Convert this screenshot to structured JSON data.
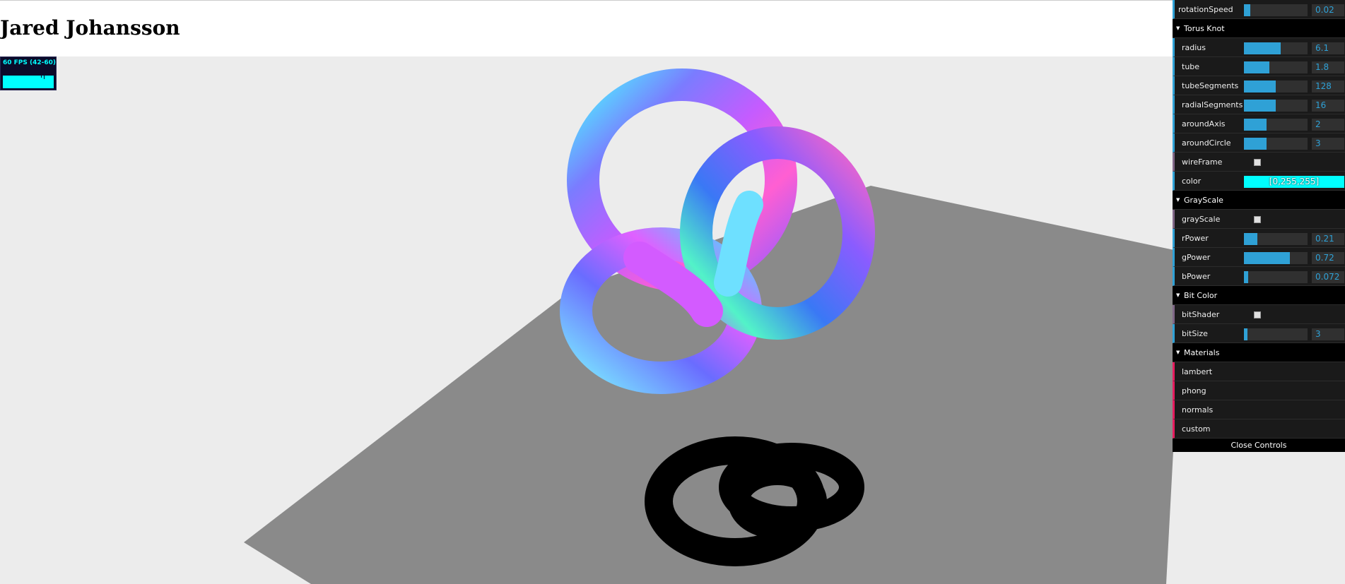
{
  "page": {
    "title": "Jared Johansson"
  },
  "stats": {
    "fps_text": "60 FPS (42-60)"
  },
  "gui": {
    "top": {
      "label": "rotationSpeed",
      "value": "0.02",
      "fill": 0.1
    },
    "folders": [
      {
        "name": "Torus Knot",
        "controls": [
          {
            "label": "radius",
            "type": "number",
            "value": "6.1",
            "fill": 0.58
          },
          {
            "label": "tube",
            "type": "number",
            "value": "1.8",
            "fill": 0.4
          },
          {
            "label": "tubeSegments",
            "type": "number",
            "value": "128",
            "fill": 0.5
          },
          {
            "label": "radialSegments",
            "type": "number",
            "value": "16",
            "fill": 0.5
          },
          {
            "label": "aroundAxis",
            "type": "number",
            "value": "2",
            "fill": 0.35
          },
          {
            "label": "aroundCircle",
            "type": "number",
            "value": "3",
            "fill": 0.35
          },
          {
            "label": "wireFrame",
            "type": "boolean",
            "checked": false
          },
          {
            "label": "color",
            "type": "color",
            "value": "[0,255,255]",
            "hex": "#00ffff"
          }
        ]
      },
      {
        "name": "GrayScale",
        "controls": [
          {
            "label": "grayScale",
            "type": "boolean",
            "checked": false
          },
          {
            "label": "rPower",
            "type": "number",
            "value": "0.21",
            "fill": 0.21
          },
          {
            "label": "gPower",
            "type": "number",
            "value": "0.72",
            "fill": 0.72
          },
          {
            "label": "bPower",
            "type": "number",
            "value": "0.072",
            "fill": 0.072
          }
        ]
      },
      {
        "name": "Bit Color",
        "controls": [
          {
            "label": "bitShader",
            "type": "boolean",
            "checked": false
          },
          {
            "label": "bitSize",
            "type": "number",
            "value": "3",
            "fill": 0.05
          }
        ]
      },
      {
        "name": "Materials",
        "controls": [
          {
            "label": "lambert",
            "type": "function"
          },
          {
            "label": "phong",
            "type": "function"
          },
          {
            "label": "normals",
            "type": "function"
          },
          {
            "label": "custom",
            "type": "function"
          }
        ]
      }
    ],
    "close_label": "Close Controls"
  },
  "colors": {
    "accent": "#2fa1d6",
    "knot_color": "#00ffff",
    "plane": "#8a8a8a",
    "shadow": "#000000",
    "background": "#ececec"
  }
}
